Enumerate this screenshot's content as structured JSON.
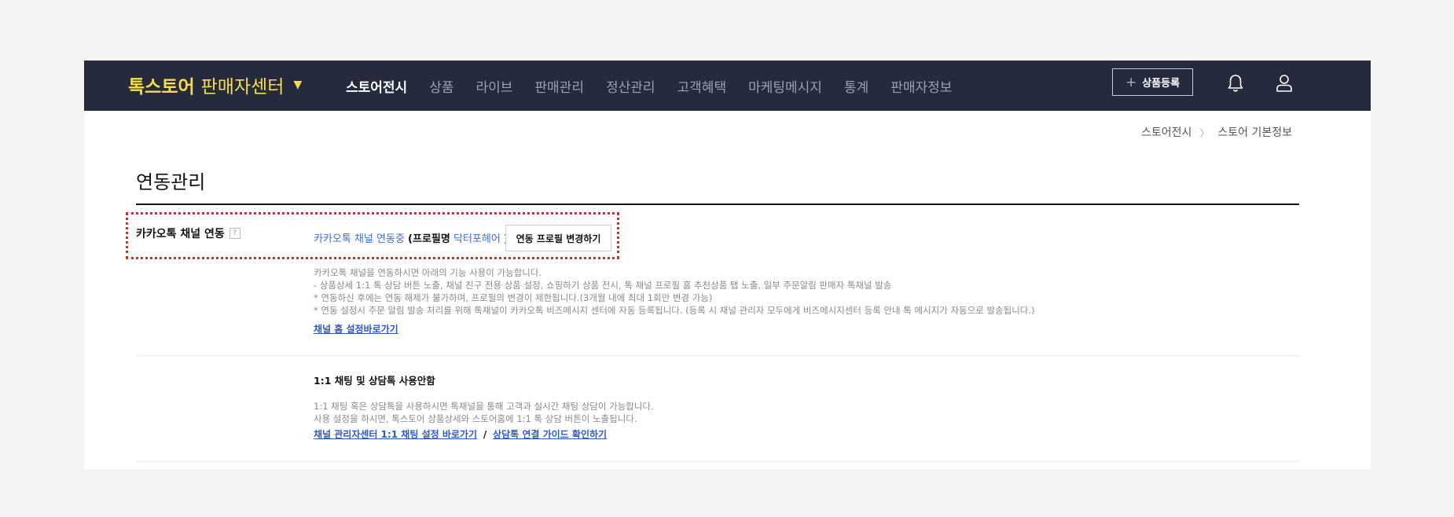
{
  "header": {
    "brand_main": "톡스토어",
    "brand_sub": "판매자센터",
    "nav": [
      {
        "label": "스토어전시",
        "active": true
      },
      {
        "label": "상품",
        "active": false
      },
      {
        "label": "라이브",
        "active": false
      },
      {
        "label": "판매관리",
        "active": false
      },
      {
        "label": "정산관리",
        "active": false
      },
      {
        "label": "고객혜택",
        "active": false
      },
      {
        "label": "마케팅메시지",
        "active": false
      },
      {
        "label": "통계",
        "active": false
      },
      {
        "label": "판매자정보",
        "active": false
      }
    ],
    "register_label": "상품등록",
    "colors": {
      "bar": "#262a3d",
      "brand": "#f5dc4a"
    }
  },
  "breadcrumb": [
    "스토어전시",
    "스토어 기본정보"
  ],
  "page": {
    "title": "연동관리"
  },
  "kakao": {
    "label": "카카오톡 채널 연동",
    "help": "?",
    "status_text": "카카오톡 채널 연동중",
    "paren_open": "(프로필명",
    "profile_name": "닥터포헤어",
    "paren_close": ")",
    "change_button": "연동 프로필 변경하기",
    "desc": [
      "카카오톡 채널을 연동하시면 아래의 기능 사용이 가능합니다.",
      "- 상품상세 1:1 톡 상담 버튼 노출, 채널 친구 전용 상품 설정, 쇼핑하기 상품 전시, 톡 채널 프로필 홈 추천상품 탭 노출, 일부 주문알림 판매자 톡채널 발송",
      "* 연동하신 후에는 연동 해제가 불가하며, 프로필의 변경이 제한됩니다.(3개월 내에 최대 1회만 변경 가능)",
      "* 연동 설정시 주문 알림 발송 처리를 위해 톡채널이 카카오톡 비즈메시지 센터에 자동 등록됩니다. (등록 시 채널 관리자 모두에게 비즈메시지센터 등록 안내 톡 메시지가 자동으로 발송됩니다.)"
    ],
    "home_link": "채널 홈 설정바로가기"
  },
  "chat": {
    "title": "1:1 채팅 및 상담톡 사용안함",
    "desc": [
      "1:1 채팅 혹은 상담톡을 사용하시면 톡채널을 통해 고객과 실시간 채팅 상담이 가능합니다.",
      "사용 설정을 하시면, 톡스토어 상품상세와 스토어홈에 1:1 톡 상담 버튼이 노출됩니다."
    ],
    "link1": "채널 관리자센터 1:1 채팅 설정 바로가기",
    "slash": "/",
    "link2": "상담톡 연결 가이드 확인하기"
  }
}
